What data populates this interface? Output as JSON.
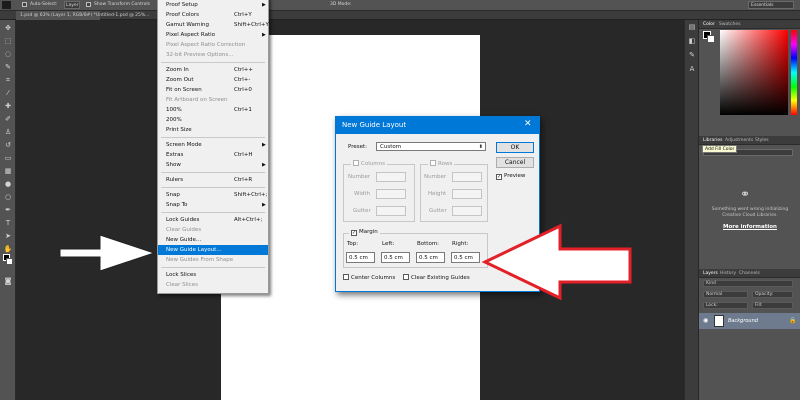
{
  "options_bar": {
    "auto_select": "Auto-Select:",
    "auto_select_target": "Layer",
    "show_transform": "Show Transform Controls",
    "mode_3d": "3D Mode:",
    "workspace": "Essentials"
  },
  "doc_tabs": [
    "1.psd @ 63% (Layer 1, RGB/8#) *",
    "Untitled-1.psd @ 25%..."
  ],
  "view_menu": {
    "items": [
      {
        "label": "Proof Setup",
        "shortcut": "",
        "submenu": true,
        "disabled": false
      },
      {
        "label": "Proof Colors",
        "shortcut": "Ctrl+Y",
        "submenu": false,
        "disabled": false
      },
      {
        "label": "Gamut Warning",
        "shortcut": "Shift+Ctrl+Y",
        "submenu": false,
        "disabled": false
      },
      {
        "label": "Pixel Aspect Ratio",
        "shortcut": "",
        "submenu": true,
        "disabled": false
      },
      {
        "label": "Pixel Aspect Ratio Correction",
        "shortcut": "",
        "submenu": false,
        "disabled": true
      },
      {
        "label": "32-bit Preview Options...",
        "shortcut": "",
        "submenu": false,
        "disabled": true
      },
      {
        "label": "Zoom In",
        "shortcut": "Ctrl++",
        "submenu": false,
        "disabled": false
      },
      {
        "label": "Zoom Out",
        "shortcut": "Ctrl+-",
        "submenu": false,
        "disabled": false
      },
      {
        "label": "Fit on Screen",
        "shortcut": "Ctrl+0",
        "submenu": false,
        "disabled": false
      },
      {
        "label": "Fit Artboard on Screen",
        "shortcut": "",
        "submenu": false,
        "disabled": true
      },
      {
        "label": "100%",
        "shortcut": "Ctrl+1",
        "submenu": false,
        "disabled": false
      },
      {
        "label": "200%",
        "shortcut": "",
        "submenu": false,
        "disabled": false
      },
      {
        "label": "Print Size",
        "shortcut": "",
        "submenu": false,
        "disabled": false
      },
      {
        "label": "Screen Mode",
        "shortcut": "",
        "submenu": true,
        "disabled": false
      },
      {
        "label": "Extras",
        "shortcut": "Ctrl+H",
        "submenu": false,
        "disabled": false
      },
      {
        "label": "Show",
        "shortcut": "",
        "submenu": true,
        "disabled": false
      },
      {
        "label": "Rulers",
        "shortcut": "Ctrl+R",
        "submenu": false,
        "disabled": false
      },
      {
        "label": "Snap",
        "shortcut": "Shift+Ctrl+;",
        "submenu": false,
        "disabled": false
      },
      {
        "label": "Snap To",
        "shortcut": "",
        "submenu": true,
        "disabled": false
      },
      {
        "label": "Lock Guides",
        "shortcut": "Alt+Ctrl+;",
        "submenu": false,
        "disabled": false
      },
      {
        "label": "Clear Guides",
        "shortcut": "",
        "submenu": false,
        "disabled": true
      },
      {
        "label": "New Guide...",
        "shortcut": "",
        "submenu": false,
        "disabled": false
      },
      {
        "label": "New Guide Layout...",
        "shortcut": "",
        "submenu": false,
        "disabled": false,
        "highlighted": true
      },
      {
        "label": "New Guides From Shape",
        "shortcut": "",
        "submenu": false,
        "disabled": true
      },
      {
        "label": "Lock Slices",
        "shortcut": "",
        "submenu": false,
        "disabled": false
      },
      {
        "label": "Clear Slices",
        "shortcut": "",
        "submenu": false,
        "disabled": true
      }
    ]
  },
  "dialog": {
    "title": "New Guide Layout",
    "close": "✕",
    "preset_label": "Preset:",
    "preset_value": "Custom",
    "ok": "OK",
    "cancel": "Cancel",
    "preview": "Preview",
    "preview_checked": true,
    "columns": {
      "title": "Columns",
      "number": "Number",
      "width": "Width",
      "gutter": "Gutter"
    },
    "rows": {
      "title": "Rows",
      "number": "Number",
      "height": "Height",
      "gutter": "Gutter"
    },
    "margin": {
      "title": "Margin",
      "checked": true,
      "top_label": "Top:",
      "left_label": "Left:",
      "bottom_label": "Bottom:",
      "right_label": "Right:",
      "top": "0.5 cm",
      "left": "0.5 cm",
      "bottom": "0.5 cm",
      "right": "0.5 cm"
    },
    "center_columns": "Center Columns",
    "clear_existing": "Clear Existing Guides"
  },
  "right_panels": {
    "color_tabs": [
      "Color",
      "Swatches"
    ],
    "library_tabs": [
      "Libraries",
      "Adjustments",
      "Styles"
    ],
    "tooltip": "Add Fill Color",
    "library_message": "Something went wrong initializing Creative Cloud Libraries.",
    "library_link": "More information",
    "layer_tabs": [
      "Layers",
      "History",
      "Channels"
    ],
    "kind_label": "Kind",
    "blend_mode": "Normal",
    "opacity_label": "Opacity:",
    "lock_label": "Lock:",
    "fill_label": "Fill:",
    "layer_name": "Background"
  },
  "colors": {
    "accent": "#0078d7",
    "ui_dark": "#282828",
    "panel": "#535353",
    "arrow_red": "#e32028"
  }
}
